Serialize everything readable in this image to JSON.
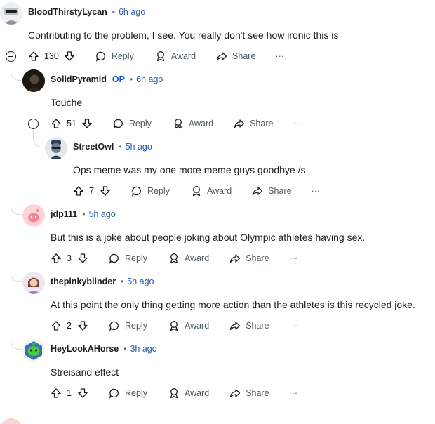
{
  "comments": [
    {
      "author": "BloodThirstyLycan",
      "op": "",
      "time": "6h ago",
      "text": "Contributing to the problem, I see. You really don't see how ironic this is",
      "score": "130"
    },
    {
      "author": "SolidPyramid",
      "op": "OP",
      "time": "6h ago",
      "text": "Touche",
      "score": "51"
    },
    {
      "author": "StreetOwl",
      "op": "",
      "time": "5h ago",
      "text": "Ops meme was my one more meme guys goodbye /s",
      "score": "7"
    },
    {
      "author": "jdp111",
      "op": "",
      "time": "5h ago",
      "text": "But this is a joke about people joking about Olympic athletes having sex.",
      "score": "3"
    },
    {
      "author": "thepinkyblinder",
      "op": "",
      "time": "5h ago",
      "text": "At this point the only thing getting more action than the athletes is this recycled joke.",
      "score": "2"
    },
    {
      "author": "HeyLookAHorse",
      "op": "",
      "time": "3h ago",
      "text": "Streisand effect",
      "score": "1"
    }
  ],
  "actions": {
    "reply": "Reply",
    "award": "Award",
    "share": "Share",
    "more": "···"
  },
  "separator": "•",
  "colors": {
    "accent": "#0a57d0",
    "time": "#2a5db0",
    "thread": "#d5d9dc"
  }
}
